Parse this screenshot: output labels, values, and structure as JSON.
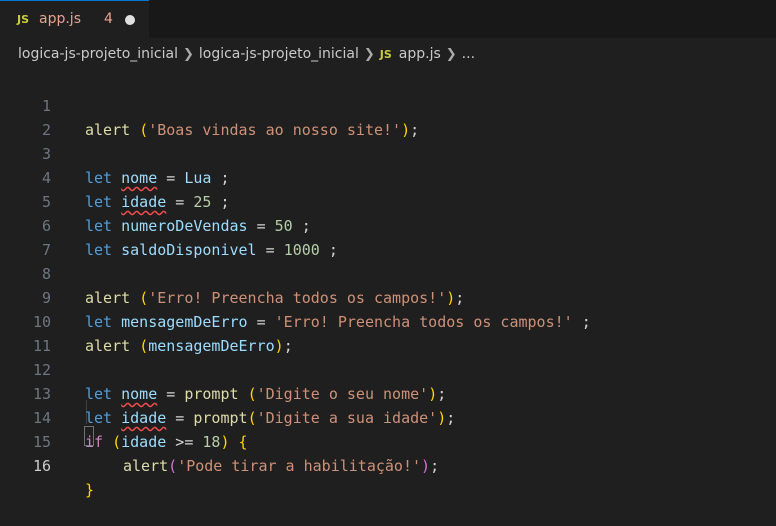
{
  "tab": {
    "icon_text": "JS",
    "filename": "app.js",
    "problems": "4"
  },
  "breadcrumbs": [
    "logica-js-projeto_inicial",
    "logica-js-projeto_inicial",
    "app.js",
    "..."
  ],
  "breadcrumb_file_icon": "JS",
  "line_numbers": [
    "1",
    "2",
    "3",
    "4",
    "5",
    "6",
    "7",
    "8",
    "9",
    "10",
    "11",
    "12",
    "13",
    "14",
    "15",
    "16"
  ],
  "code": {
    "l1": {
      "fn": "alert",
      "sp": " ",
      "open": "(",
      "str": "'Boas vindas ao nosso site!'",
      "close": ")",
      "semi": ";"
    },
    "l3": {
      "kw": "let",
      "var": "nome",
      "eq": " = ",
      "val": "Lua",
      "semi": " ;"
    },
    "l4": {
      "kw": "let",
      "var": "idade",
      "eq": " = ",
      "num": "25",
      "semi": " ;"
    },
    "l5": {
      "kw": "let",
      "var": "numeroDeVendas",
      "eq": " = ",
      "num": "50",
      "semi": " ;"
    },
    "l6": {
      "kw": "let",
      "var": "saldoDisponivel",
      "eq": " = ",
      "num": "1000",
      "semi": " ;"
    },
    "l8": {
      "fn": "alert",
      "open": "(",
      "str": "'Erro! Preencha todos os campos!'",
      "close": ")",
      "semi": ";"
    },
    "l9": {
      "kw": "let",
      "var": "mensagemDeErro",
      "eq": " = ",
      "str": "'Erro! Preencha todos os campos!'",
      "semi": " ;"
    },
    "l10": {
      "fn": "alert",
      "open": "(",
      "arg": "mensagemDeErro",
      "close": ")",
      "semi": ";"
    },
    "l12": {
      "kw": "let",
      "var": "nome",
      "eq": " = ",
      "fn": "prompt",
      "open": "(",
      "str": "'Digite o seu nome'",
      "close": ")",
      "semi": ";"
    },
    "l13": {
      "kw": "let",
      "var": "idade",
      "eq": " = ",
      "fn": "prompt",
      "open": "(",
      "str": "'Digite a sua idade'",
      "close": ")",
      "semi": ";"
    },
    "l14": {
      "kw": "if",
      "open": "(",
      "var": "idade",
      "op": " >= ",
      "num": "18",
      "close": ")",
      "brace": "{"
    },
    "l15": {
      "fn": "alert",
      "open": "(",
      "str": "'Pode tirar a habilitação!'",
      "close": ")",
      "semi": ";"
    },
    "l16": {
      "brace": "}"
    }
  },
  "colors": {
    "keyword": "#569cd6",
    "control": "#c586c0",
    "function": "#dcdcaa",
    "variable": "#9cdcfe",
    "string": "#ce9178",
    "number": "#b5cea8",
    "error_underline": "#f14c4c"
  }
}
